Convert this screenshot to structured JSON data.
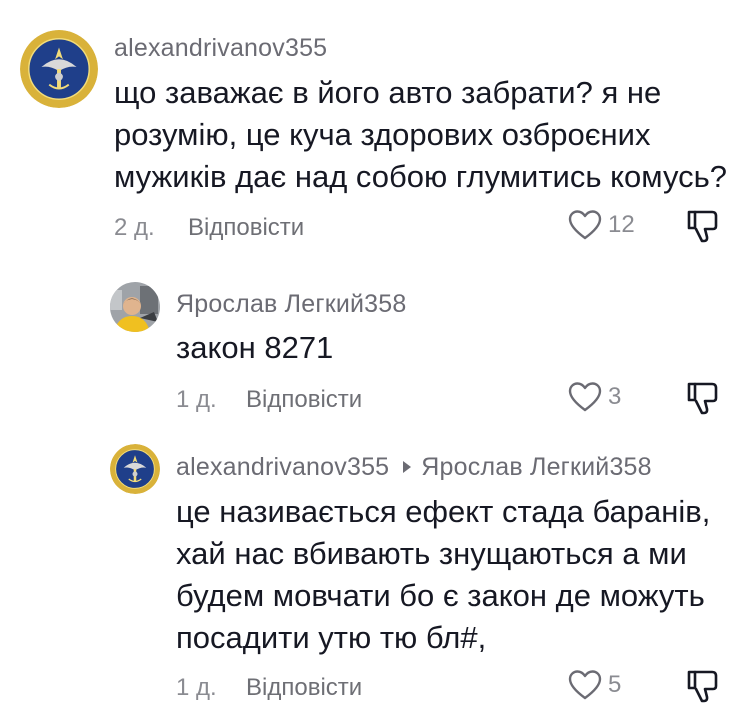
{
  "comments": [
    {
      "username": "alexandrivanov355",
      "lines": [
        "що заважає в його авто забрати? я не",
        "розумію, це куча здорових озброєних",
        "мужиків дає над собою глумитись комусь?"
      ],
      "time": "2 д.",
      "reply_label": "Відповісти",
      "likes": "12",
      "avatar_icon": "intelligence-emblem-icon"
    },
    {
      "username": "Ярослав Легкий358",
      "lines": [
        "закон 8271"
      ],
      "time": "1 д.",
      "reply_label": "Відповісти",
      "likes": "3",
      "avatar_icon": "user-photo-avatar"
    },
    {
      "username": "alexandrivanov355",
      "reply_to": "Ярослав Легкий358",
      "lines": [
        "це називається ефект стада баранів,",
        "хай нас вбивають знущаються а ми",
        "будем мовчати бо є закон де можуть",
        "посадити утю тю бл#,"
      ],
      "time": "1 д.",
      "reply_label": "Відповісти",
      "likes": "5",
      "avatar_icon": "intelligence-emblem-icon"
    }
  ],
  "colors": {
    "text": "#161823",
    "secondary": "#6b6b73",
    "emblem_blue": "#1f3f8a",
    "emblem_gold": "#d9b23a"
  }
}
